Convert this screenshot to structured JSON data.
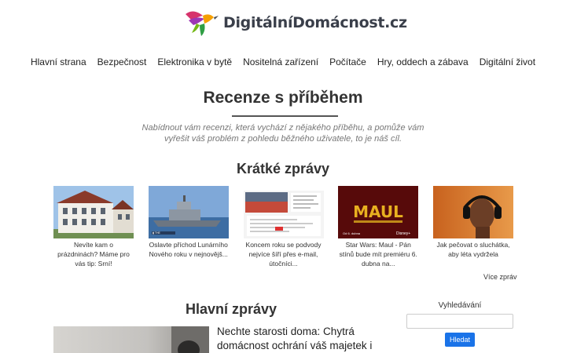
{
  "site": {
    "logo_text": "DigitálníDomácnost.cz"
  },
  "nav": [
    "Hlavní strana",
    "Bezpečnost",
    "Elektronika v bytě",
    "Nositelná zařízení",
    "Počítače",
    "Hry, oddech a zábava",
    "Digitální život"
  ],
  "hero": {
    "title": "Recenze s příběhem",
    "subtitle": "Nabídnout vám recenzi, která vychází z nějakého příběhu, a pomůže vám vyřešit váš problém z pohledu běžného uživatele, to je náš cíl."
  },
  "short_news": {
    "title": "Krátké zprávy",
    "items": [
      {
        "caption": "Nevíte kam o prázdninách? Máme pro vás tip: Srní!",
        "thumb": "building-photo"
      },
      {
        "caption": "Oslavte příchod Lunárního Nového roku v nejnovějš...",
        "thumb": "ship-photo"
      },
      {
        "caption": "Koncem roku se podvody nejvíce šíří přes e-mail, útočníci...",
        "thumb": "email-screenshot"
      },
      {
        "caption": "Star Wars: Maul - Pán stínů bude mít premiéru 6. dubna na...",
        "thumb": "maul-poster"
      },
      {
        "caption": "Jak pečovat o sluchátka, aby léta vydržela",
        "thumb": "headphones-photo"
      }
    ],
    "more": "Více zpráv"
  },
  "main_news": {
    "title": "Hlavní zprávy",
    "headline": "Nechte starosti doma: Chytrá domácnost ochrání váš majetek i"
  },
  "search": {
    "label": "Vyhledávání",
    "placeholder": "",
    "button": "Hledat"
  },
  "colors": {
    "accent": "#1a73e8",
    "logo_pink": "#d6336c",
    "logo_green": "#2f9e44"
  }
}
